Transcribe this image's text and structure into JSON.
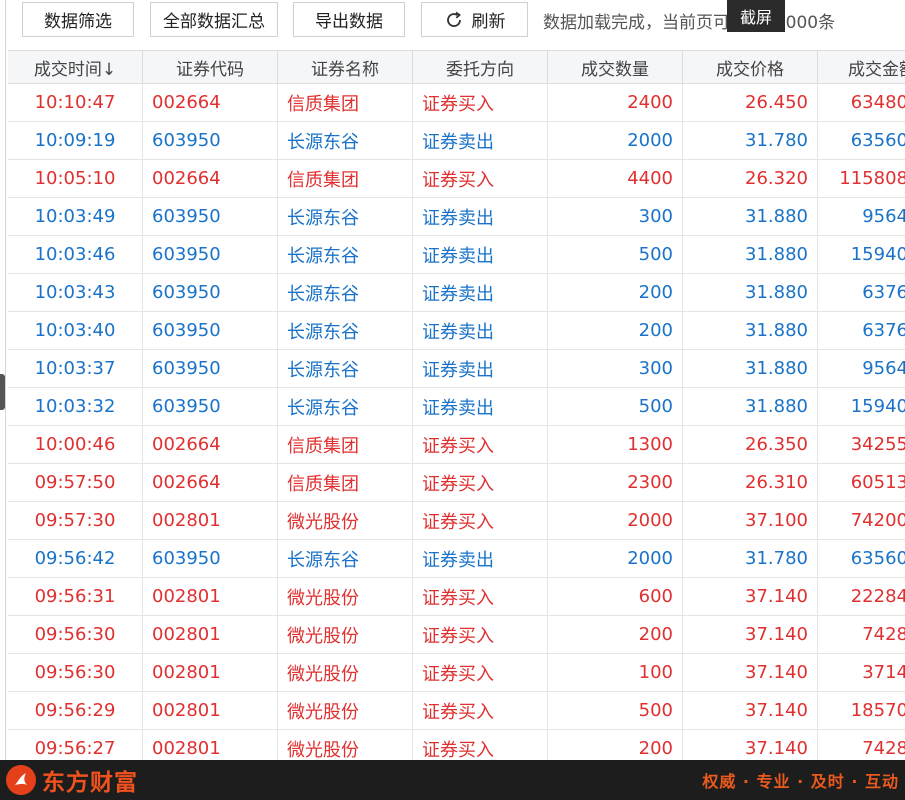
{
  "toolbar": {
    "filter_label": "数据筛选",
    "summary_label": "全部数据汇总",
    "export_label": "导出数据",
    "refresh_label": "刷新",
    "status_text": "数据加载完成，当前页可查询10000条",
    "tooltip_text": "截屏"
  },
  "table": {
    "headers": [
      "成交时间↓",
      "证券代码",
      "证券名称",
      "委托方向",
      "成交数量",
      "成交价格",
      "成交金额"
    ],
    "buy_color": "#e03030",
    "sell_color": "#1a73c8",
    "rows": [
      {
        "time": "10:10:47",
        "code": "002664",
        "name": "信质集团",
        "dir": "证券买入",
        "qty": "2400",
        "price": "26.450",
        "amount": "63480",
        "side": "buy"
      },
      {
        "time": "10:09:19",
        "code": "603950",
        "name": "长源东谷",
        "dir": "证券卖出",
        "qty": "2000",
        "price": "31.780",
        "amount": "63560",
        "side": "sell"
      },
      {
        "time": "10:05:10",
        "code": "002664",
        "name": "信质集团",
        "dir": "证券买入",
        "qty": "4400",
        "price": "26.320",
        "amount": "115808",
        "side": "buy"
      },
      {
        "time": "10:03:49",
        "code": "603950",
        "name": "长源东谷",
        "dir": "证券卖出",
        "qty": "300",
        "price": "31.880",
        "amount": "9564",
        "side": "sell"
      },
      {
        "time": "10:03:46",
        "code": "603950",
        "name": "长源东谷",
        "dir": "证券卖出",
        "qty": "500",
        "price": "31.880",
        "amount": "15940",
        "side": "sell"
      },
      {
        "time": "10:03:43",
        "code": "603950",
        "name": "长源东谷",
        "dir": "证券卖出",
        "qty": "200",
        "price": "31.880",
        "amount": "6376",
        "side": "sell"
      },
      {
        "time": "10:03:40",
        "code": "603950",
        "name": "长源东谷",
        "dir": "证券卖出",
        "qty": "200",
        "price": "31.880",
        "amount": "6376",
        "side": "sell"
      },
      {
        "time": "10:03:37",
        "code": "603950",
        "name": "长源东谷",
        "dir": "证券卖出",
        "qty": "300",
        "price": "31.880",
        "amount": "9564",
        "side": "sell"
      },
      {
        "time": "10:03:32",
        "code": "603950",
        "name": "长源东谷",
        "dir": "证券卖出",
        "qty": "500",
        "price": "31.880",
        "amount": "15940",
        "side": "sell"
      },
      {
        "time": "10:00:46",
        "code": "002664",
        "name": "信质集团",
        "dir": "证券买入",
        "qty": "1300",
        "price": "26.350",
        "amount": "34255",
        "side": "buy"
      },
      {
        "time": "09:57:50",
        "code": "002664",
        "name": "信质集团",
        "dir": "证券买入",
        "qty": "2300",
        "price": "26.310",
        "amount": "60513",
        "side": "buy"
      },
      {
        "time": "09:57:30",
        "code": "002801",
        "name": "微光股份",
        "dir": "证券买入",
        "qty": "2000",
        "price": "37.100",
        "amount": "74200",
        "side": "buy"
      },
      {
        "time": "09:56:42",
        "code": "603950",
        "name": "长源东谷",
        "dir": "证券卖出",
        "qty": "2000",
        "price": "31.780",
        "amount": "63560",
        "side": "sell"
      },
      {
        "time": "09:56:31",
        "code": "002801",
        "name": "微光股份",
        "dir": "证券买入",
        "qty": "600",
        "price": "37.140",
        "amount": "22284",
        "side": "buy"
      },
      {
        "time": "09:56:30",
        "code": "002801",
        "name": "微光股份",
        "dir": "证券买入",
        "qty": "200",
        "price": "37.140",
        "amount": "7428",
        "side": "buy"
      },
      {
        "time": "09:56:30",
        "code": "002801",
        "name": "微光股份",
        "dir": "证券买入",
        "qty": "100",
        "price": "37.140",
        "amount": "3714",
        "side": "buy"
      },
      {
        "time": "09:56:29",
        "code": "002801",
        "name": "微光股份",
        "dir": "证券买入",
        "qty": "500",
        "price": "37.140",
        "amount": "18570",
        "side": "buy"
      },
      {
        "time": "09:56:27",
        "code": "002801",
        "name": "微光股份",
        "dir": "证券买入",
        "qty": "200",
        "price": "37.140",
        "amount": "7428",
        "side": "buy"
      }
    ]
  },
  "footer": {
    "brand": "东方财富",
    "slogan": "权威 · 专业 · 及时 · 互动",
    "logo_icon": "dongfang-logo-icon"
  }
}
